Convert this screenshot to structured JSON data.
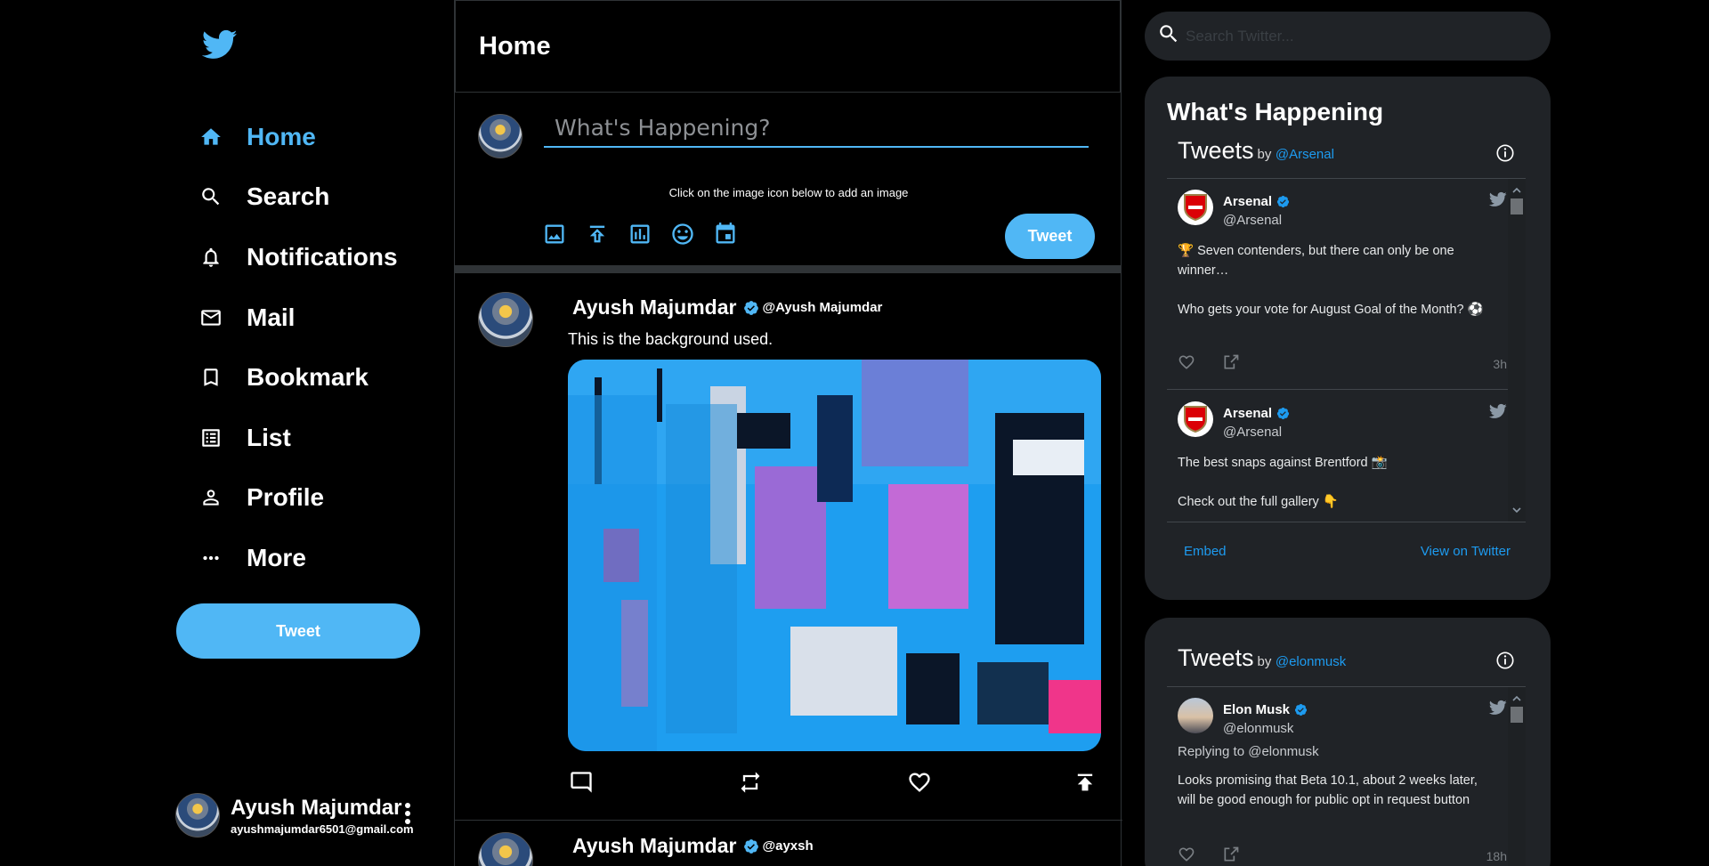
{
  "colors": {
    "accent": "#50b7f5",
    "background": "#000000",
    "panel": "#202327",
    "link": "#1d9bf0"
  },
  "nav": {
    "items": [
      {
        "label": "Home",
        "icon": "home-icon"
      },
      {
        "label": "Search",
        "icon": "search-icon"
      },
      {
        "label": "Notifications",
        "icon": "bell-icon"
      },
      {
        "label": "Mail",
        "icon": "mail-icon"
      },
      {
        "label": "Bookmark",
        "icon": "bookmark-icon"
      },
      {
        "label": "List",
        "icon": "list-icon"
      },
      {
        "label": "Profile",
        "icon": "person-icon"
      },
      {
        "label": "More",
        "icon": "more-horizontal-icon"
      }
    ],
    "tweet_label": "Tweet"
  },
  "profile": {
    "name": "Ayush Majumdar",
    "email": "ayushmajumdar6501@gmail.com"
  },
  "feed": {
    "title": "Home",
    "compose": {
      "placeholder": "What's Happening?",
      "hint": "Click on the image icon below to add an image",
      "tweet_label": "Tweet"
    },
    "posts": [
      {
        "name": "Ayush Majumdar",
        "handle": "@Ayush Majumdar",
        "text": "This is the background used."
      },
      {
        "name": "Ayush Majumdar",
        "handle": "@ayxsh"
      }
    ]
  },
  "right": {
    "search_placeholder": "Search Twitter...",
    "widget_title": "What's Happening",
    "timeline1": {
      "title": "Tweets",
      "by": "by",
      "handle": "@Arsenal",
      "tweets": [
        {
          "name": "Arsenal",
          "handle": "@Arsenal",
          "line1": "🏆 Seven contenders, but there can only be one winner…",
          "line2": "Who gets your vote for August Goal of the Month? ⚽",
          "time": "3h"
        },
        {
          "name": "Arsenal",
          "handle": "@Arsenal",
          "line1": "The best snaps against Brentford 📸",
          "line2": "Check out the full gallery 👇"
        }
      ],
      "embed": "Embed",
      "view": "View on Twitter"
    },
    "timeline2": {
      "title": "Tweets",
      "by": "by",
      "handle": "@elonmusk",
      "tweet": {
        "name": "Elon Musk",
        "handle": "@elonmusk",
        "reply": "Replying to @elonmusk",
        "body": "Looks promising that Beta 10.1, about 2 weeks later, will be good enough for public opt in request button",
        "time": "18h"
      }
    }
  }
}
